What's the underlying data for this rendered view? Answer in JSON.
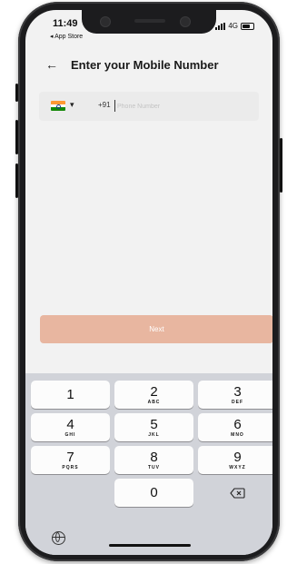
{
  "status_bar": {
    "time": "11:49",
    "back_app": "◂ App Store",
    "network": "4G"
  },
  "header": {
    "title": "Enter your Mobile Number"
  },
  "phone_input": {
    "country_code": "+91",
    "placeholder": "Phone Number",
    "value": ""
  },
  "next_button": {
    "label": "Next"
  },
  "keypad": {
    "keys": [
      {
        "num": "1",
        "letters": ""
      },
      {
        "num": "2",
        "letters": "ABC"
      },
      {
        "num": "3",
        "letters": "DEF"
      },
      {
        "num": "4",
        "letters": "GHI"
      },
      {
        "num": "5",
        "letters": "JKL"
      },
      {
        "num": "6",
        "letters": "MNO"
      },
      {
        "num": "7",
        "letters": "PQRS"
      },
      {
        "num": "8",
        "letters": "TUV"
      },
      {
        "num": "9",
        "letters": "WXYZ"
      },
      {
        "num": "0",
        "letters": ""
      }
    ]
  },
  "colors": {
    "next_button_bg": "#e8b6a0",
    "screen_bg": "#f2f2f2",
    "keyboard_bg": "#d1d3d9"
  },
  "icons": {
    "back": "arrow-left-icon",
    "dropdown": "chevron-down-icon",
    "delete": "backspace-icon",
    "globe": "globe-icon",
    "flag": "india-flag-icon"
  }
}
